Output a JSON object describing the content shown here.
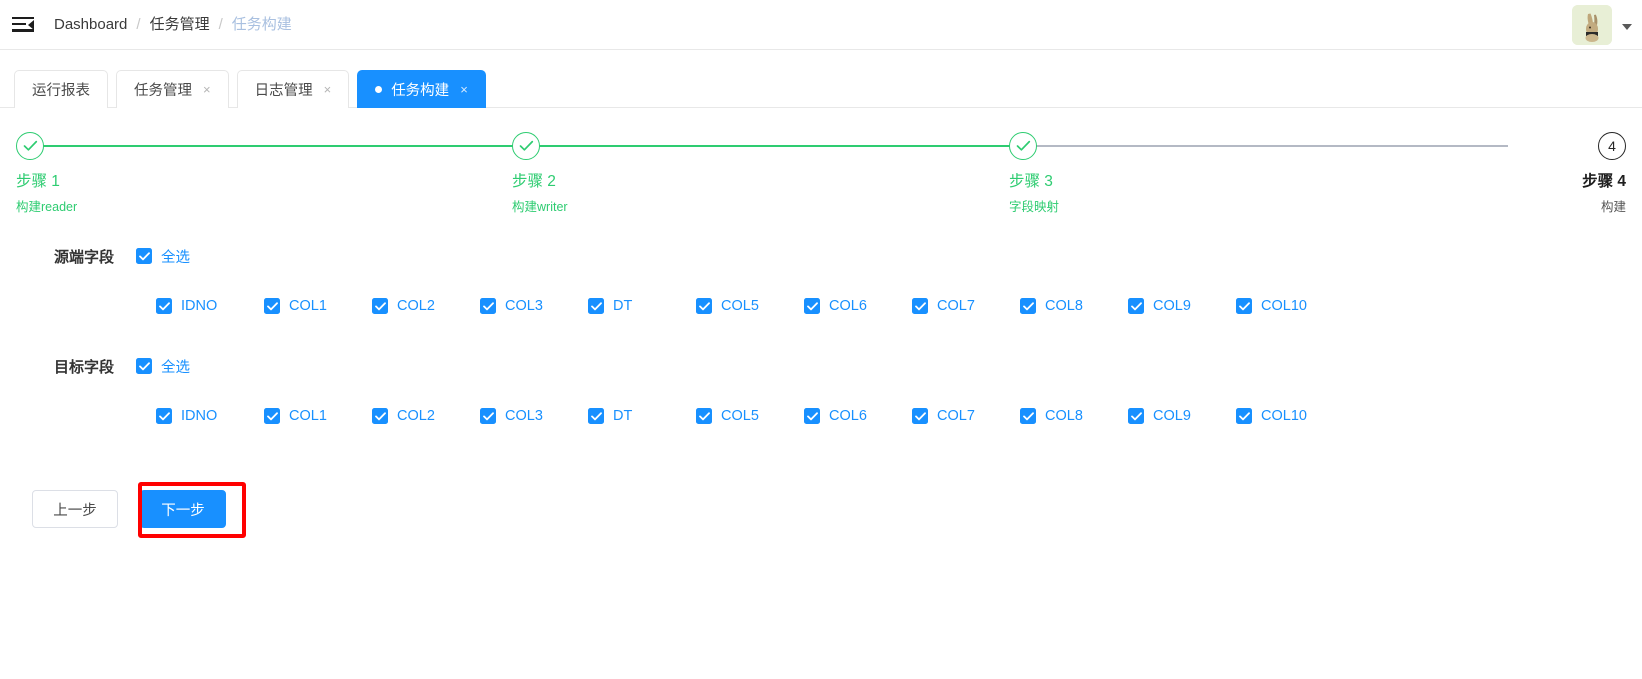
{
  "header": {
    "menu_icon": "menu-fold-icon",
    "breadcrumb": [
      {
        "label": "Dashboard",
        "current": false
      },
      {
        "label": "任务管理",
        "current": false
      },
      {
        "label": "任务构建",
        "current": true
      }
    ],
    "separator": "/",
    "avatar_icon": "rabbit-avatar",
    "caret_icon": "chevron-down-icon"
  },
  "tabs": [
    {
      "label": "运行报表",
      "closable": false,
      "active": false,
      "dot": false
    },
    {
      "label": "任务管理",
      "closable": true,
      "active": false,
      "dot": false
    },
    {
      "label": "日志管理",
      "closable": true,
      "active": false,
      "dot": false
    },
    {
      "label": "任务构建",
      "closable": true,
      "active": true,
      "dot": true
    }
  ],
  "tab_close_glyph": "×",
  "steps": [
    {
      "title": "步骤 1",
      "desc": "构建reader",
      "status": "done",
      "indicator": "check"
    },
    {
      "title": "步骤 2",
      "desc": "构建writer",
      "status": "done",
      "indicator": "check"
    },
    {
      "title": "步骤 3",
      "desc": "字段映射",
      "status": "done",
      "indicator": "check"
    },
    {
      "title": "步骤 4",
      "desc": "构建",
      "status": "pending",
      "indicator": "4"
    }
  ],
  "source_section": {
    "label": "源端字段",
    "select_all_label": "全选",
    "select_all_checked": true,
    "fields": [
      {
        "label": "IDNO",
        "checked": true
      },
      {
        "label": "COL1",
        "checked": true
      },
      {
        "label": "COL2",
        "checked": true
      },
      {
        "label": "COL3",
        "checked": true
      },
      {
        "label": "DT",
        "checked": true
      },
      {
        "label": "COL5",
        "checked": true
      },
      {
        "label": "COL6",
        "checked": true
      },
      {
        "label": "COL7",
        "checked": true
      },
      {
        "label": "COL8",
        "checked": true
      },
      {
        "label": "COL9",
        "checked": true
      },
      {
        "label": "COL10",
        "checked": true
      }
    ]
  },
  "target_section": {
    "label": "目标字段",
    "select_all_label": "全选",
    "select_all_checked": true,
    "fields": [
      {
        "label": "IDNO",
        "checked": true
      },
      {
        "label": "COL1",
        "checked": true
      },
      {
        "label": "COL2",
        "checked": true
      },
      {
        "label": "COL3",
        "checked": true
      },
      {
        "label": "DT",
        "checked": true
      },
      {
        "label": "COL5",
        "checked": true
      },
      {
        "label": "COL6",
        "checked": true
      },
      {
        "label": "COL7",
        "checked": true
      },
      {
        "label": "COL8",
        "checked": true
      },
      {
        "label": "COL9",
        "checked": true
      },
      {
        "label": "COL10",
        "checked": true
      }
    ]
  },
  "footer": {
    "prev_label": "上一步",
    "next_label": "下一步",
    "next_highlighted": true
  },
  "colors": {
    "primary": "#1890ff",
    "success": "#2ecc71",
    "pending": "#b4b9c4",
    "highlight": "#ff0000",
    "breadcrumb_current": "#a9c0e0"
  }
}
